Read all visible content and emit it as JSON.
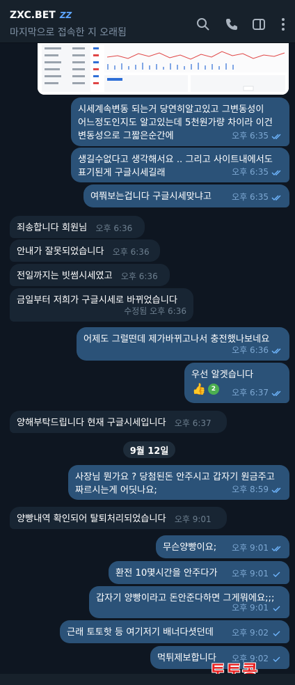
{
  "header": {
    "title": "ZXC.BET",
    "badge": "ZZ",
    "status": "마지막으로 접속한 지 오래됨",
    "icons": [
      "search-icon",
      "phone-icon",
      "sidebar-icon",
      "more-icon"
    ]
  },
  "messages": [
    {
      "dir": "out",
      "text": "시세계속변동 되는거 당연히알고있고 그변동성이\n어느정도인지도 알고있는데 5천원가량 차이라 이건\n변동성으로 그짧은순간에",
      "time": "오후 6:35",
      "status": "read"
    },
    {
      "dir": "out",
      "text": "생길수없다고 생각해서요 .. 그리고 사이트내에서도\n표기된게 구글시세길래",
      "time": "오후 6:35",
      "status": "read"
    },
    {
      "dir": "out",
      "text": "여쭤보는겁니다 구글시세맞냐고",
      "time": "오후 6:35",
      "status": "read"
    },
    {
      "dir": "in",
      "text": "죄송합니다 회원님",
      "time": "오후 6:36"
    },
    {
      "dir": "in",
      "text": "안내가 잘못되었습니다",
      "time": "오후 6:36"
    },
    {
      "dir": "in",
      "text": "전일까지는 빗썸시세였고",
      "time": "오후 6:36"
    },
    {
      "dir": "in",
      "text": "금일부터 저희가 구글시세로 바뀌었습니다",
      "time": "수정됨 오후 6:36"
    },
    {
      "dir": "out",
      "text": "어제도 그럴떤데 제가바뀌고나서 충전했나보네요",
      "time": "오후 6:36",
      "status": "read"
    },
    {
      "dir": "out",
      "text": "우선 알겟습니다",
      "time": "오후 6:37",
      "status": "read"
    },
    {
      "dir": "in",
      "text": "양해부탁드립니다 현재 구글시세입니다",
      "time": "오후 6:37"
    },
    {
      "dir": "out",
      "text": "사장님 뭔가요 ? 당첨된돈 안주시고 갑자기 원금주고\n짜르시는게 어딧나요;",
      "time": "오후 8:59",
      "status": "read"
    },
    {
      "dir": "in",
      "text": "양빵내역 확인되어 탈퇴처리되었습니다",
      "time": "오후 9:01"
    },
    {
      "dir": "out",
      "text": "무슨양빵이요;",
      "time": "오후 9:01",
      "status": "read"
    },
    {
      "dir": "out",
      "text": "환전 10몇시간을 안주다가",
      "time": "오후 9:01",
      "status": "sent"
    },
    {
      "dir": "out",
      "text": "갑자기 양빵이라고 돈안준다하면 그게뭐에요;;;",
      "time": "오후 9:01",
      "status": "sent"
    },
    {
      "dir": "out",
      "text": "근래 토토핫 등 여기저기 배너다셧던데",
      "time": "오후 9:02",
      "status": "sent"
    },
    {
      "dir": "out",
      "text": "먹튀제보합니다",
      "time": "오후 9:02",
      "status": "sent"
    }
  ],
  "reaction": {
    "emoji": "👍",
    "count": "2"
  },
  "date_divider": "9월 12일",
  "watermark": "토토콩",
  "colors": {
    "background": "#0e1621",
    "header": "#17212b",
    "outgoing_bubble": "#2b5278",
    "incoming_bubble": "#182533",
    "accent": "#5ea6ff"
  }
}
